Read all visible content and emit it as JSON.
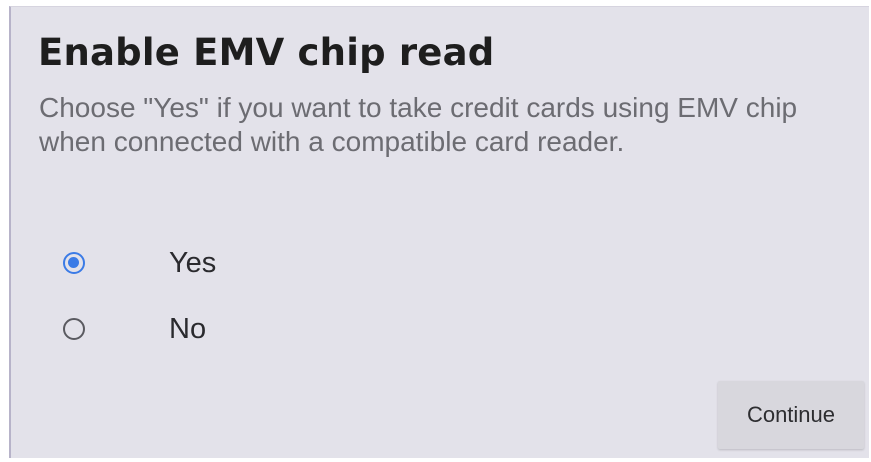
{
  "dialog": {
    "title": "Enable EMV chip read",
    "description": "Choose \"Yes\" if you want to take credit cards using EMV chip when connected with a compatible card reader.",
    "options": [
      {
        "label": "Yes",
        "selected": true
      },
      {
        "label": "No",
        "selected": false
      }
    ],
    "continue_label": "Continue"
  },
  "colors": {
    "background": "#e3e2ea",
    "accent": "#3b7be6",
    "title_text": "#1e1e1e",
    "description_text": "#6c6c72",
    "button_bg": "#d8d7dd"
  },
  "icons": {
    "selected": "radio-checked-icon",
    "unselected": "radio-unchecked-icon"
  }
}
